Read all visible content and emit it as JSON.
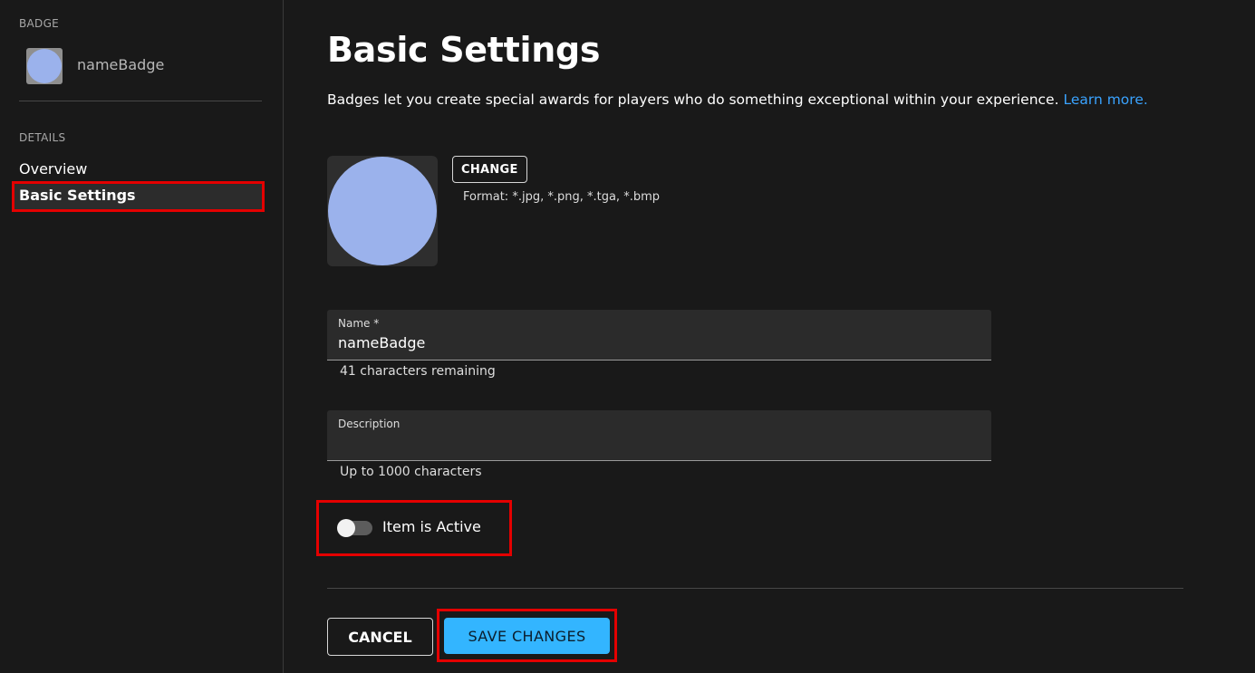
{
  "sidebar": {
    "badge_section_label": "BADGE",
    "badge_name": "nameBadge",
    "details_section_label": "DETAILS",
    "items": [
      {
        "label": "Overview",
        "active": false
      },
      {
        "label": "Basic Settings",
        "active": true
      }
    ]
  },
  "main": {
    "title": "Basic Settings",
    "intro_text": "Badges let you create special awards for players who do something exceptional within your experience.",
    "learn_more_label": "Learn more.",
    "image": {
      "change_label": "CHANGE",
      "format_text": "Format: *.jpg, *.png, *.tga, *.bmp"
    },
    "name_field": {
      "label": "Name *",
      "value": "nameBadge",
      "helper": "41 characters remaining"
    },
    "description_field": {
      "label": "Description",
      "value": "",
      "helper": "Up to 1000 characters"
    },
    "active_toggle": {
      "label": "Item is Active",
      "on": false
    },
    "actions": {
      "cancel_label": "CANCEL",
      "save_label": "SAVE CHANGES"
    }
  },
  "colors": {
    "background": "#191919",
    "accent": "#33b5ff",
    "link": "#3aa3ff",
    "highlight": "#e40000",
    "badge_circle": "#9bb2ec"
  }
}
